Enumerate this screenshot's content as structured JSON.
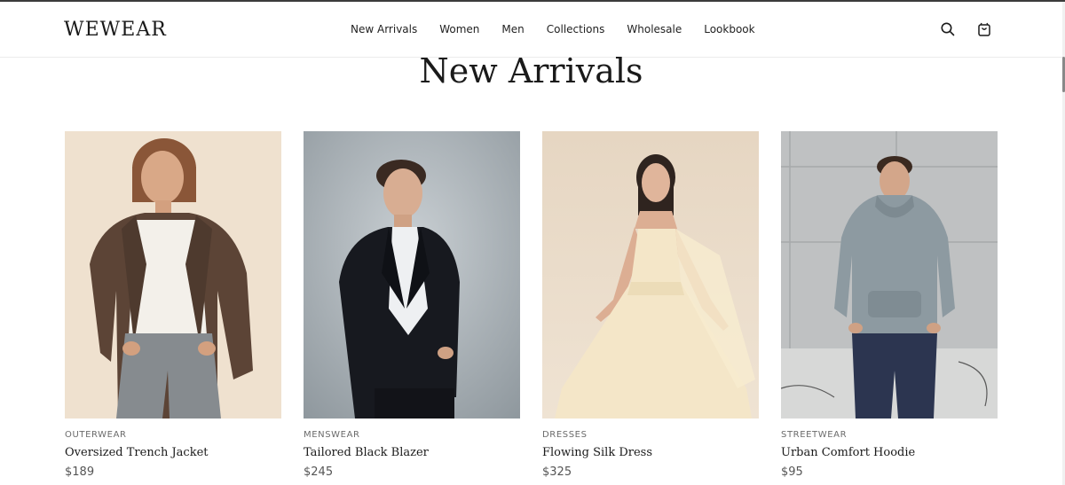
{
  "brand": {
    "logo_text": "WEWEAR"
  },
  "nav": {
    "items": [
      {
        "label": "New Arrivals"
      },
      {
        "label": "Women"
      },
      {
        "label": "Men"
      },
      {
        "label": "Collections"
      },
      {
        "label": "Wholesale"
      },
      {
        "label": "Lookbook"
      }
    ]
  },
  "header_icons": {
    "search": "search-icon",
    "cart": "shopping-bag-icon"
  },
  "section": {
    "title": "New Arrivals"
  },
  "products": [
    {
      "category": "OUTERWEAR",
      "name": "Oversized Trench Jacket",
      "price": "$189"
    },
    {
      "category": "MENSWEAR",
      "name": "Tailored Black Blazer",
      "price": "$245"
    },
    {
      "category": "DRESSES",
      "name": "Flowing Silk Dress",
      "price": "$325"
    },
    {
      "category": "STREETWEAR",
      "name": "Urban Comfort Hoodie",
      "price": "$95"
    }
  ],
  "colors": {
    "text": "#1a1a1a",
    "muted": "#6b6b6b",
    "border": "#ececec",
    "background": "#ffffff"
  }
}
